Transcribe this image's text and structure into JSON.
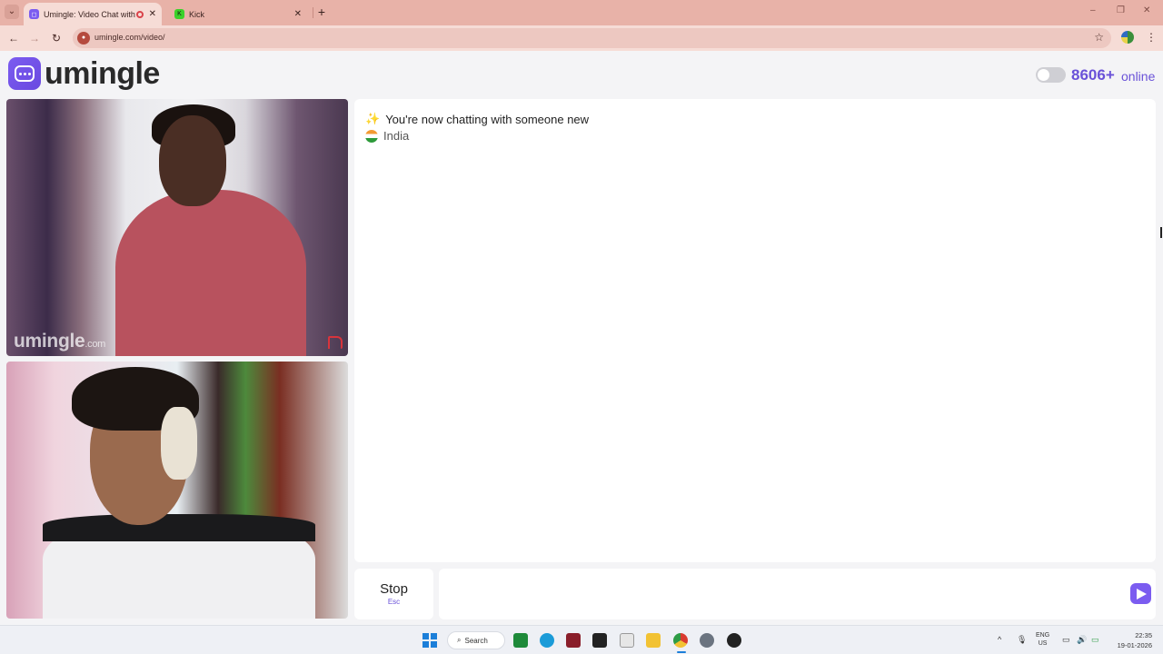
{
  "browser": {
    "tabs": [
      {
        "title": "Umingle: Video Chat with S",
        "active": true
      },
      {
        "title": "Kick",
        "active": false
      }
    ],
    "url": "umingle.com/video/",
    "new_tab_icon": "+",
    "window_controls": {
      "minimize": "–",
      "restore": "❐",
      "close": "✕"
    }
  },
  "header": {
    "logo_text": "umingle",
    "online_count": "8606+",
    "online_label": "online",
    "toggle_on": false
  },
  "videos": {
    "stranger_watermark": "umingle",
    "stranger_watermark_suffix": ".com"
  },
  "chat": {
    "system_message": "You're now chatting with someone new",
    "country": "India",
    "message_placeholder": ""
  },
  "controls": {
    "stop_label": "Stop",
    "stop_shortcut": "Esc"
  },
  "taskbar": {
    "search_label": "Search",
    "language": "ENG",
    "region": "US",
    "time": "22:35",
    "date": "19-01-2026"
  },
  "colors": {
    "brand": "#7b5cf0",
    "online_text": "#6a52d8",
    "tabbar": "#e8b2a8",
    "report": "#d8343c"
  }
}
